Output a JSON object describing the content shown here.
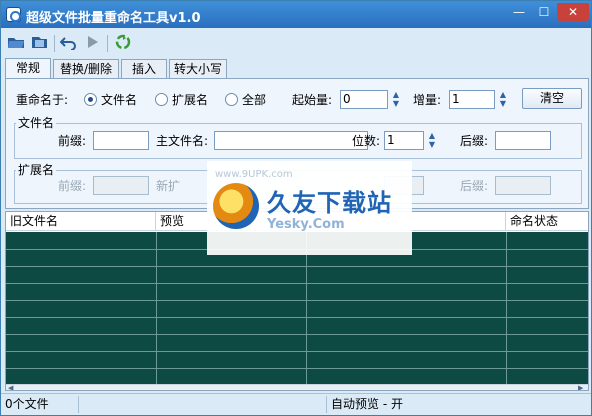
{
  "window": {
    "title": "超级文件批量重命名工具v1.0",
    "min_glyph": "—",
    "max_glyph": "☐",
    "close_glyph": "✕"
  },
  "toolbar": {
    "icons": [
      "open-folder-icon",
      "open-file-icon",
      "undo-icon",
      "run-icon",
      "recycle-icon"
    ]
  },
  "tabs": [
    "常规",
    "替换/删除",
    "插入",
    "转大小写"
  ],
  "rename": {
    "label": "重命名于:",
    "options": [
      "文件名",
      "扩展名",
      "全部"
    ],
    "selected": 0,
    "start_label": "起始量:",
    "start_value": "0",
    "step_label": "增量:",
    "step_value": "1",
    "clear_label": "清空"
  },
  "filename_group": {
    "title": "文件名",
    "prefix_label": "前缀:",
    "prefix_value": "",
    "main_label": "主文件名:",
    "main_value": "",
    "digits_label": "位数:",
    "digits_value": "1",
    "suffix_label": "后缀:",
    "suffix_value": ""
  },
  "ext_group": {
    "title": "扩展名",
    "prefix_label": "前缀:",
    "new_label": "新扩",
    "suffix_label": "后缀:"
  },
  "list": {
    "columns": [
      "旧文件名",
      "预览",
      "",
      "命名状态"
    ]
  },
  "watermark": {
    "big": "久友下载站",
    "small": "Yesky.Com",
    "url": "www.9UPK.com"
  },
  "status": {
    "count": "0个文件",
    "blank": "",
    "preview": "自动预览 - 开"
  },
  "colors": {
    "titlebar": "#2f7ccb",
    "grid_background": "#0e4a44",
    "close": "#c8423b"
  }
}
